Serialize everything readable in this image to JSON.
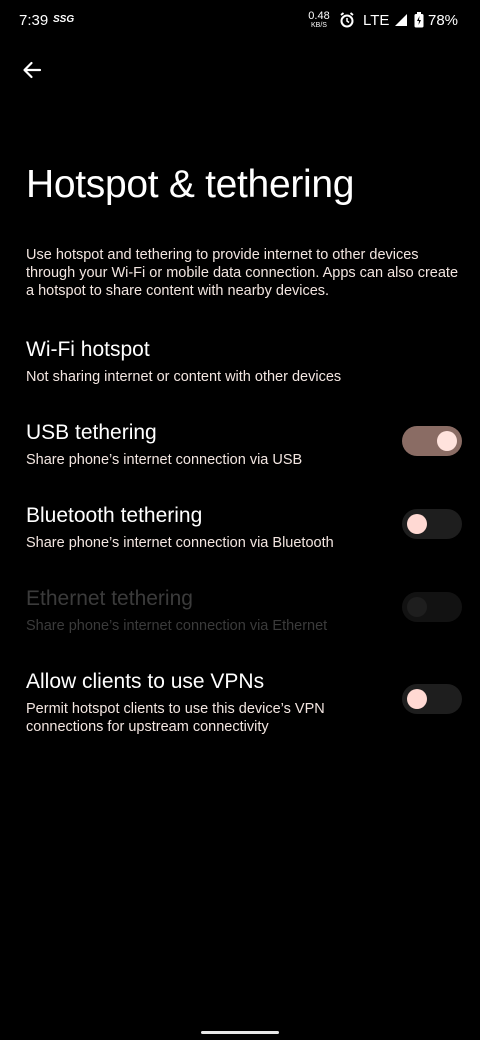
{
  "status_bar": {
    "time": "7:39",
    "carrier_badge": "SSG",
    "net_speed_value": "0.48",
    "net_speed_unit": "KB/S",
    "network_type": "LTE",
    "battery_percent": "78%"
  },
  "header": {
    "title": "Hotspot & tethering"
  },
  "intro": {
    "text": "Use hotspot and tethering to provide internet to other devices through your Wi-Fi or mobile data connection. Apps can also create a hotspot to share content with nearby devices."
  },
  "settings": [
    {
      "title": "Wi-Fi hotspot",
      "summary": "Not sharing internet or content with other devices"
    },
    {
      "title": "USB tethering",
      "summary": "Share phone’s internet connection via USB",
      "toggle_on": true
    },
    {
      "title": "Bluetooth tethering",
      "summary": "Share phone’s internet connection via Bluetooth",
      "toggle_on": false
    },
    {
      "title": "Ethernet tethering",
      "summary": "Share phone’s internet connection via Ethernet",
      "toggle_on": false,
      "disabled": true
    },
    {
      "title": "Allow clients to use VPNs",
      "summary": "Permit hotspot clients to use this device’s VPN connections for upstream connectivity",
      "toggle_on": false
    }
  ],
  "colors": {
    "background": "#000000",
    "toggle_on_track": "#8a6c64",
    "toggle_thumb": "#ffd9d3",
    "disabled_text": "#3b3b3b"
  }
}
